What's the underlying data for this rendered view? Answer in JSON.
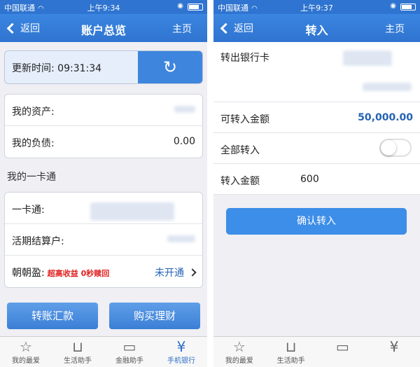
{
  "left": {
    "status": {
      "carrier": "中国联通",
      "time": "上午9:34"
    },
    "nav": {
      "back": "返回",
      "title": "账户总览",
      "home": "主页"
    },
    "update_label": "更新时间: 09:31:34",
    "assets_label": "我的资产:",
    "liabilities_label": "我的负债:",
    "liabilities_value": "0.00",
    "section_title": "我的一卡通",
    "card_label": "一卡通:",
    "current_label": "活期结算户:",
    "zzy_label": "朝朝盈:",
    "zzy_promo_1": "超高收益",
    "zzy_promo_2": "0秒赎回",
    "zzy_status": "未开通",
    "btn_transfer": "转账汇款",
    "btn_buy": "购买理财",
    "tabs": [
      "我的最爱",
      "生活助手",
      "金融助手",
      "手机银行"
    ]
  },
  "right": {
    "status": {
      "carrier": "中国联通",
      "time": "上午9:37"
    },
    "nav": {
      "back": "返回",
      "title": "转入",
      "home": "主页"
    },
    "from_label": "转出银行卡",
    "available_label": "可转入金额",
    "available_value": "50,000.00",
    "all_label": "全部转入",
    "amount_label": "转入金额",
    "amount_value": "600",
    "confirm": "确认转入",
    "tabs": [
      "我的最爱",
      "生活助手"
    ]
  },
  "colors": {
    "primary": "#2f74d0",
    "amount": "#2563b3",
    "promo": "#e02020"
  }
}
